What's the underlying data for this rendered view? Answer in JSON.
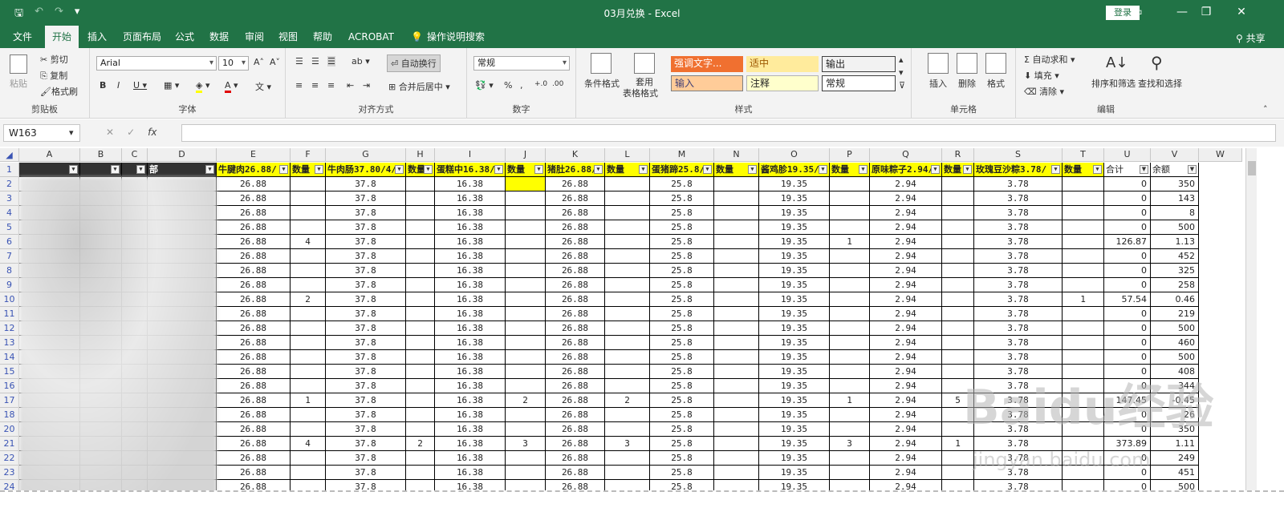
{
  "title": "03月兑换 - Excel",
  "login": "登录",
  "share": "共享",
  "tabs": [
    "文件",
    "开始",
    "插入",
    "页面布局",
    "公式",
    "数据",
    "审阅",
    "视图",
    "帮助",
    "ACROBAT",
    "操作说明搜索"
  ],
  "ribbon": {
    "clipboard": {
      "label": "剪贴板",
      "paste": "粘贴",
      "cut": "剪切",
      "copy": "复制",
      "painter": "格式刷"
    },
    "font": {
      "label": "字体",
      "name": "Arial",
      "size": "10"
    },
    "align": {
      "label": "对齐方式",
      "wrap": "自动换行",
      "merge": "合并后居中"
    },
    "number": {
      "label": "数字",
      "format": "常规"
    },
    "styles": {
      "label": "样式",
      "cond": "条件格式",
      "table": "套用",
      "table2": "表格格式",
      "s1": "强调文字...",
      "s2": "适中",
      "s3": "输出",
      "s4": "输入",
      "s5": "注释",
      "s6": "常规"
    },
    "cells": {
      "label": "单元格",
      "insert": "插入",
      "delete": "删除",
      "format": "格式"
    },
    "edit": {
      "label": "编辑",
      "autosum": "自动求和",
      "fill": "填充",
      "clear": "清除",
      "sort": "排序和筛选",
      "find": "查找和选择"
    }
  },
  "namebox": "W163",
  "columns": [
    "A",
    "B",
    "C",
    "D",
    "E",
    "F",
    "G",
    "H",
    "I",
    "J",
    "K",
    "L",
    "M",
    "N",
    "O",
    "P",
    "Q",
    "R",
    "S",
    "T",
    "U",
    "V",
    "W"
  ],
  "header_row": {
    "E": "牛腱肉26.88/",
    "F": "数量",
    "G": "牛肉肠37.80/4/",
    "H": "数量",
    "I": "蛋糕中16.38/",
    "J": "数量",
    "K": "猪肚26.88/",
    "L": "数量",
    "M": "蛋猪蹄25.8/",
    "N": "数量",
    "O": "酱鸡胗19.35/",
    "P": "数量",
    "Q": "原味粽子2.94/",
    "R": "数量",
    "S": "玫瑰豆沙粽3.78/",
    "T": "数量",
    "U": "合计",
    "V": "余额",
    "D": "部"
  },
  "prices": {
    "E": "26.88",
    "G": "37.8",
    "I": "16.38",
    "K": "26.88",
    "M": "25.8",
    "O": "19.35",
    "Q": "2.94",
    "S": "3.78"
  },
  "rows": [
    {
      "n": "2",
      "F": "",
      "H": "",
      "J": "",
      "L": "",
      "N": "",
      "P": "",
      "R": "",
      "T": "",
      "U": "0",
      "V": "350"
    },
    {
      "n": "3",
      "F": "",
      "H": "",
      "J": "",
      "L": "",
      "N": "",
      "P": "",
      "R": "",
      "T": "",
      "U": "0",
      "V": "143"
    },
    {
      "n": "4",
      "F": "",
      "H": "",
      "J": "",
      "L": "",
      "N": "",
      "P": "",
      "R": "",
      "T": "",
      "U": "0",
      "V": "8"
    },
    {
      "n": "5",
      "F": "",
      "H": "",
      "J": "",
      "L": "",
      "N": "",
      "P": "",
      "R": "",
      "T": "",
      "U": "0",
      "V": "500"
    },
    {
      "n": "6",
      "F": "4",
      "H": "",
      "J": "",
      "L": "",
      "N": "",
      "P": "1",
      "R": "",
      "T": "",
      "U": "126.87",
      "V": "1.13"
    },
    {
      "n": "7",
      "F": "",
      "H": "",
      "J": "",
      "L": "",
      "N": "",
      "P": "",
      "R": "",
      "T": "",
      "U": "0",
      "V": "452"
    },
    {
      "n": "8",
      "F": "",
      "H": "",
      "J": "",
      "L": "",
      "N": "",
      "P": "",
      "R": "",
      "T": "",
      "U": "0",
      "V": "325"
    },
    {
      "n": "9",
      "F": "",
      "H": "",
      "J": "",
      "L": "",
      "N": "",
      "P": "",
      "R": "",
      "T": "",
      "U": "0",
      "V": "258"
    },
    {
      "n": "10",
      "F": "2",
      "H": "",
      "J": "",
      "L": "",
      "N": "",
      "P": "",
      "R": "",
      "T": "1",
      "U": "57.54",
      "V": "0.46"
    },
    {
      "n": "11",
      "F": "",
      "H": "",
      "J": "",
      "L": "",
      "N": "",
      "P": "",
      "R": "",
      "T": "",
      "U": "0",
      "V": "219"
    },
    {
      "n": "12",
      "F": "",
      "H": "",
      "J": "",
      "L": "",
      "N": "",
      "P": "",
      "R": "",
      "T": "",
      "U": "0",
      "V": "500"
    },
    {
      "n": "13",
      "F": "",
      "H": "",
      "J": "",
      "L": "",
      "N": "",
      "P": "",
      "R": "",
      "T": "",
      "U": "0",
      "V": "460"
    },
    {
      "n": "14",
      "F": "",
      "H": "",
      "J": "",
      "L": "",
      "N": "",
      "P": "",
      "R": "",
      "T": "",
      "U": "0",
      "V": "500"
    },
    {
      "n": "15",
      "F": "",
      "H": "",
      "J": "",
      "L": "",
      "N": "",
      "P": "",
      "R": "",
      "T": "",
      "U": "0",
      "V": "408"
    },
    {
      "n": "16",
      "F": "",
      "H": "",
      "J": "",
      "L": "",
      "N": "",
      "P": "",
      "R": "",
      "T": "",
      "U": "0",
      "V": "344"
    },
    {
      "n": "17",
      "F": "1",
      "H": "",
      "J": "2",
      "L": "2",
      "N": "",
      "P": "1",
      "R": "5",
      "T": "",
      "U": "147.45",
      "V": "-0.45"
    },
    {
      "n": "18",
      "F": "",
      "H": "",
      "J": "",
      "L": "",
      "N": "",
      "P": "",
      "R": "",
      "T": "",
      "U": "0",
      "V": "26"
    },
    {
      "n": "20",
      "F": "",
      "H": "",
      "J": "",
      "L": "",
      "N": "",
      "P": "",
      "R": "",
      "T": "",
      "U": "0",
      "V": "350"
    },
    {
      "n": "21",
      "F": "4",
      "H": "2",
      "J": "3",
      "L": "3",
      "N": "",
      "P": "3",
      "R": "1",
      "T": "",
      "U": "373.89",
      "V": "1.11"
    },
    {
      "n": "22",
      "F": "",
      "H": "",
      "J": "",
      "L": "",
      "N": "",
      "P": "",
      "R": "",
      "T": "",
      "U": "0",
      "V": "249"
    },
    {
      "n": "23",
      "F": "",
      "H": "",
      "J": "",
      "L": "",
      "N": "",
      "P": "",
      "R": "",
      "T": "",
      "U": "0",
      "V": "451"
    },
    {
      "n": "24",
      "F": "",
      "H": "",
      "J": "",
      "L": "",
      "N": "",
      "P": "",
      "R": "",
      "T": "",
      "U": "0",
      "V": "500"
    }
  ],
  "watermark": "Baidu经验",
  "watermark_sub": "jingyan.baidu.com",
  "colors": {
    "excel_green": "#217346",
    "header_yellow": "#ffff00",
    "style_red": "#f4b183"
  }
}
